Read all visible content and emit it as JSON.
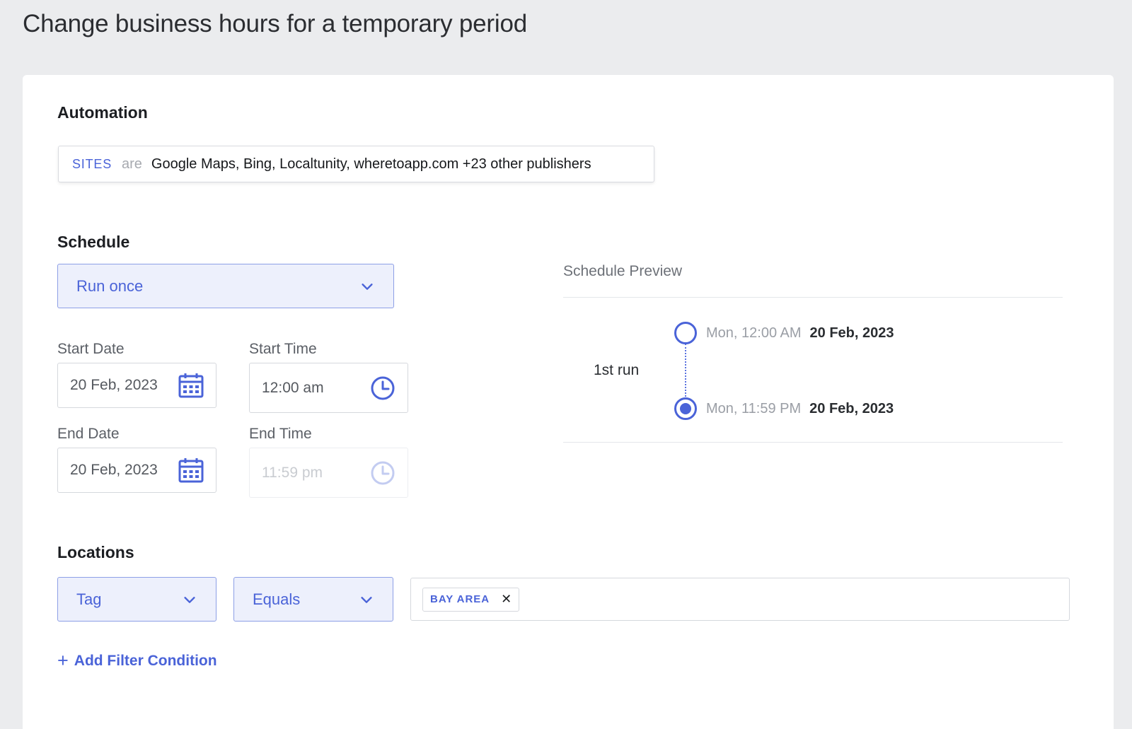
{
  "page": {
    "title": "Change business hours for a temporary period"
  },
  "automation": {
    "title": "Automation",
    "key": "SITES",
    "operator": "are",
    "value": "Google Maps, Bing, Localtunity, wheretoapp.com +23 other publishers"
  },
  "schedule": {
    "title": "Schedule",
    "frequency": "Run once",
    "start_date_label": "Start Date",
    "start_date": "20 Feb, 2023",
    "start_time_label": "Start Time",
    "start_time": "12:00 am",
    "end_date_label": "End Date",
    "end_date": "20 Feb, 2023",
    "end_time_label": "End Time",
    "end_time": "11:59 pm"
  },
  "preview": {
    "title": "Schedule Preview",
    "run_label": "1st run",
    "start_day": "Mon, 12:00 AM",
    "start_date": "20 Feb, 2023",
    "end_day": "Mon, 11:59 PM",
    "end_date": "20 Feb, 2023"
  },
  "locations": {
    "title": "Locations",
    "field": "Tag",
    "operator": "Equals",
    "chips": [
      "BAY AREA"
    ],
    "add_filter_label": "Add Filter Condition"
  },
  "colors": {
    "accent": "#4a63d8",
    "select_bg": "#edf0fc",
    "page_bg": "#ebecee"
  },
  "icons": [
    "calendar-icon",
    "clock-icon",
    "chevron-down-icon",
    "close-icon",
    "plus-icon"
  ]
}
